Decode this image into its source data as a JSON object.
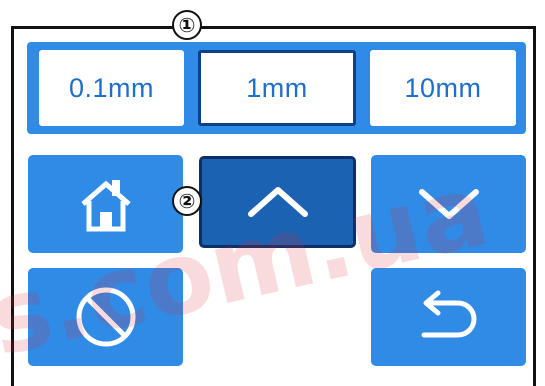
{
  "callouts": {
    "one": "①",
    "two": "②"
  },
  "step_sizes": [
    {
      "label": "0.1mm",
      "selected": false
    },
    {
      "label": "1mm",
      "selected": true
    },
    {
      "label": "10mm",
      "selected": false
    }
  ],
  "keys": {
    "home": {
      "icon": "home-icon"
    },
    "up": {
      "icon": "chevron-up-icon",
      "pressed": true
    },
    "down": {
      "icon": "chevron-down-icon"
    },
    "stop": {
      "icon": "prohibit-icon"
    },
    "back": {
      "icon": "return-arrow-icon"
    }
  },
  "watermark": {
    "text": "s.com.ua"
  },
  "colors": {
    "accent": "#2f8be6",
    "pressed": "#1b62b3",
    "pressed_border": "#0e3f8c",
    "text_blue": "#1f6fc8"
  }
}
